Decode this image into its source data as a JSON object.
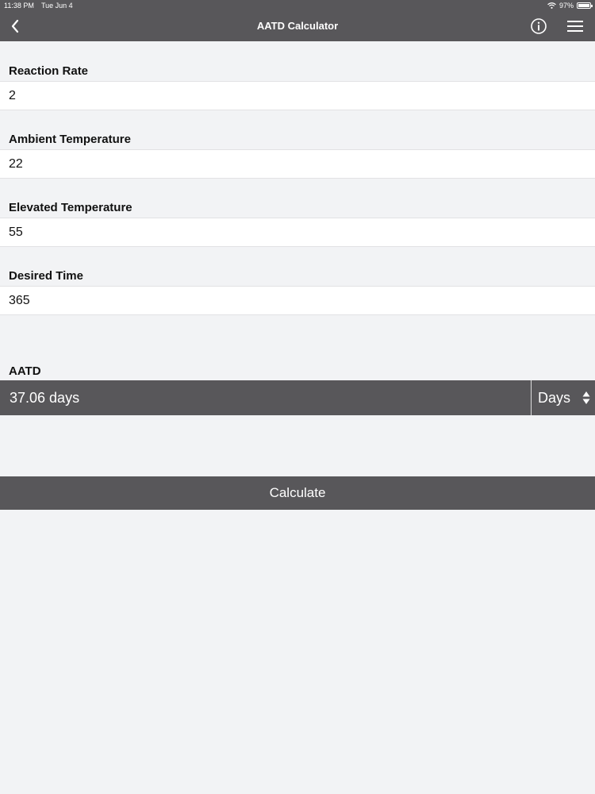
{
  "status_bar": {
    "time": "11:38 PM",
    "date": "Tue Jun 4",
    "battery": "97%",
    "icons": [
      "wifi-icon",
      "battery-icon"
    ]
  },
  "nav": {
    "title": "AATD Calculator",
    "icons": [
      "back-chevron-icon",
      "info-icon",
      "hamburger-menu-icon"
    ]
  },
  "fields": {
    "reaction_rate": {
      "label": "Reaction Rate",
      "value": "2"
    },
    "ambient_temperature": {
      "label": "Ambient Temperature",
      "value": "22"
    },
    "elevated_temperature": {
      "label": "Elevated Temperature",
      "value": "55"
    },
    "desired_time": {
      "label": "Desired Time",
      "value": "365"
    }
  },
  "result": {
    "label": "AATD",
    "value": "37.06 days",
    "unit": "Days",
    "unit_icon": "sort-arrows-icon"
  },
  "actions": {
    "calculate": "Calculate"
  },
  "colors": {
    "bar": "#58575a",
    "background": "#f2f3f5",
    "field": "#ffffff",
    "text": "#111111"
  }
}
